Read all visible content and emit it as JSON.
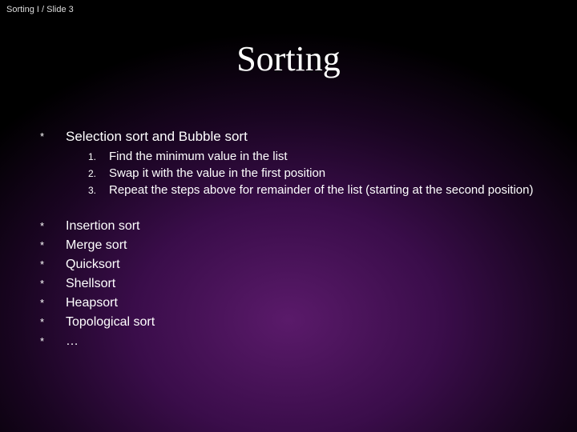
{
  "header": {
    "breadcrumb": "Sorting I  / Slide 3"
  },
  "title": "Sorting",
  "main_item": {
    "bullet": "*",
    "label": "Selection sort and Bubble sort",
    "steps": [
      {
        "num": "1.",
        "text": "Find the minimum value in the list"
      },
      {
        "num": "2.",
        "text": "Swap it with the value in the first position"
      },
      {
        "num": "3.",
        "text": "Repeat the steps above for remainder of the list (starting at the second position)"
      }
    ]
  },
  "other_items": [
    {
      "bullet": "*",
      "label": "Insertion sort"
    },
    {
      "bullet": "*",
      "label": "Merge sort"
    },
    {
      "bullet": "*",
      "label": "Quicksort"
    },
    {
      "bullet": "*",
      "label": "Shellsort"
    },
    {
      "bullet": "*",
      "label": "Heapsort"
    },
    {
      "bullet": "*",
      "label": "Topological sort"
    },
    {
      "bullet": "*",
      "label": "…"
    }
  ]
}
